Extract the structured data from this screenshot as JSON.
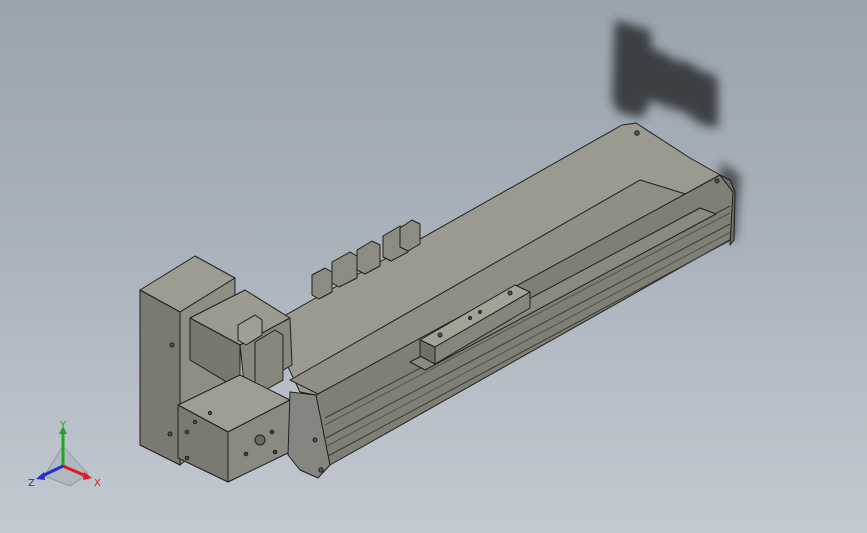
{
  "viewport": {
    "background_top": "#9aa4ae",
    "background_bottom": "#c3c9d1"
  },
  "model": {
    "part_color": "#8e8e84",
    "edge_color": "#1f1f1c"
  },
  "triad": {
    "x_label": "X",
    "y_label": "Y",
    "z_label": "Z",
    "x_color": "#d81e1e",
    "y_color": "#1fa81f",
    "z_color": "#2a2ad8"
  }
}
